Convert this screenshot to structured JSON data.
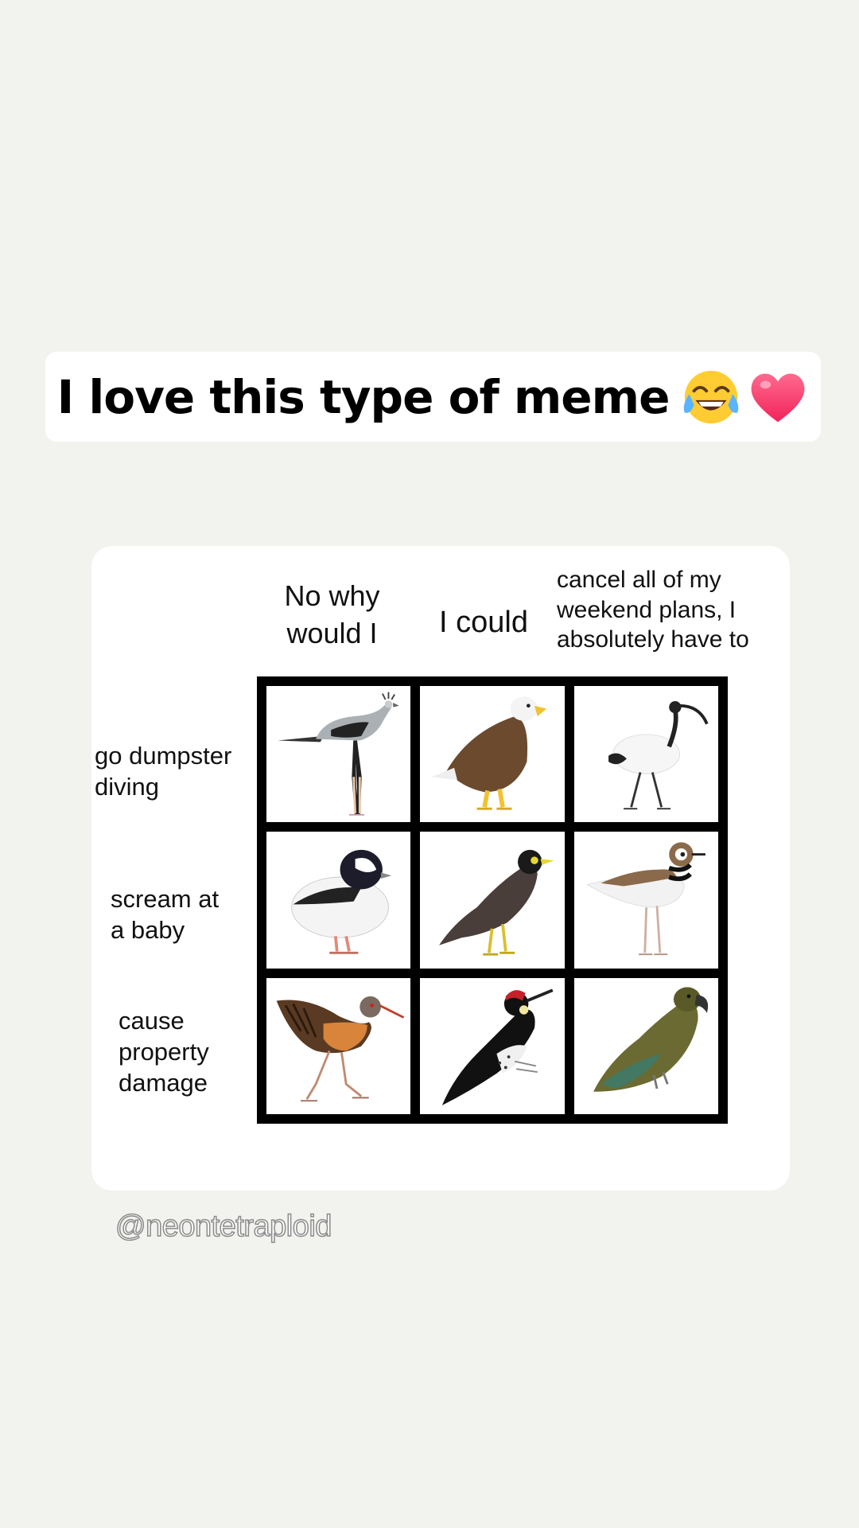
{
  "caption": {
    "text": "I love this type of meme"
  },
  "meme": {
    "columns": [
      {
        "line1": "No why",
        "line2": "would I",
        "line3": ""
      },
      {
        "line1": "I could",
        "line2": "",
        "line3": ""
      },
      {
        "line1": "cancel all of my",
        "line2": "weekend plans, I",
        "line3": "absolutely have to"
      }
    ],
    "rows": [
      {
        "line1": "go dumpster",
        "line2": "diving",
        "line3": ""
      },
      {
        "line1": "scream at",
        "line2": "a baby",
        "line3": ""
      },
      {
        "line1": "cause",
        "line2": "property",
        "line3": "damage"
      }
    ]
  },
  "watermark": {
    "text": "@neontetraploid"
  }
}
